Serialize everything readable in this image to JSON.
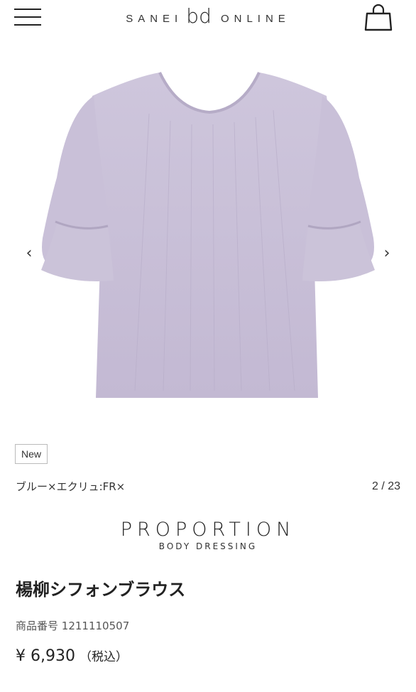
{
  "header": {
    "logo_left": "SANEI",
    "logo_mark": "bd",
    "logo_right": "ONLINE",
    "menu_icon": "hamburger-menu-icon",
    "cart_icon": "shopping-bag-icon"
  },
  "gallery": {
    "image": "lavender-chiffon-blouse",
    "prev_icon": "chevron-left-icon",
    "next_icon": "chevron-right-icon",
    "counter": "2 / 23"
  },
  "product": {
    "badge": "New",
    "color": "ブルー×エクリュ:FR×",
    "brand_name": "PROPORTION",
    "brand_sub": "BODY DRESSING",
    "title": "楊柳シフォンブラウス",
    "sku_label": "商品番号",
    "sku": "1211110507",
    "price": "¥ 6,930",
    "tax_note": "（税込）"
  },
  "colors": {
    "garment": "#c8bfd6",
    "text": "#222222"
  }
}
